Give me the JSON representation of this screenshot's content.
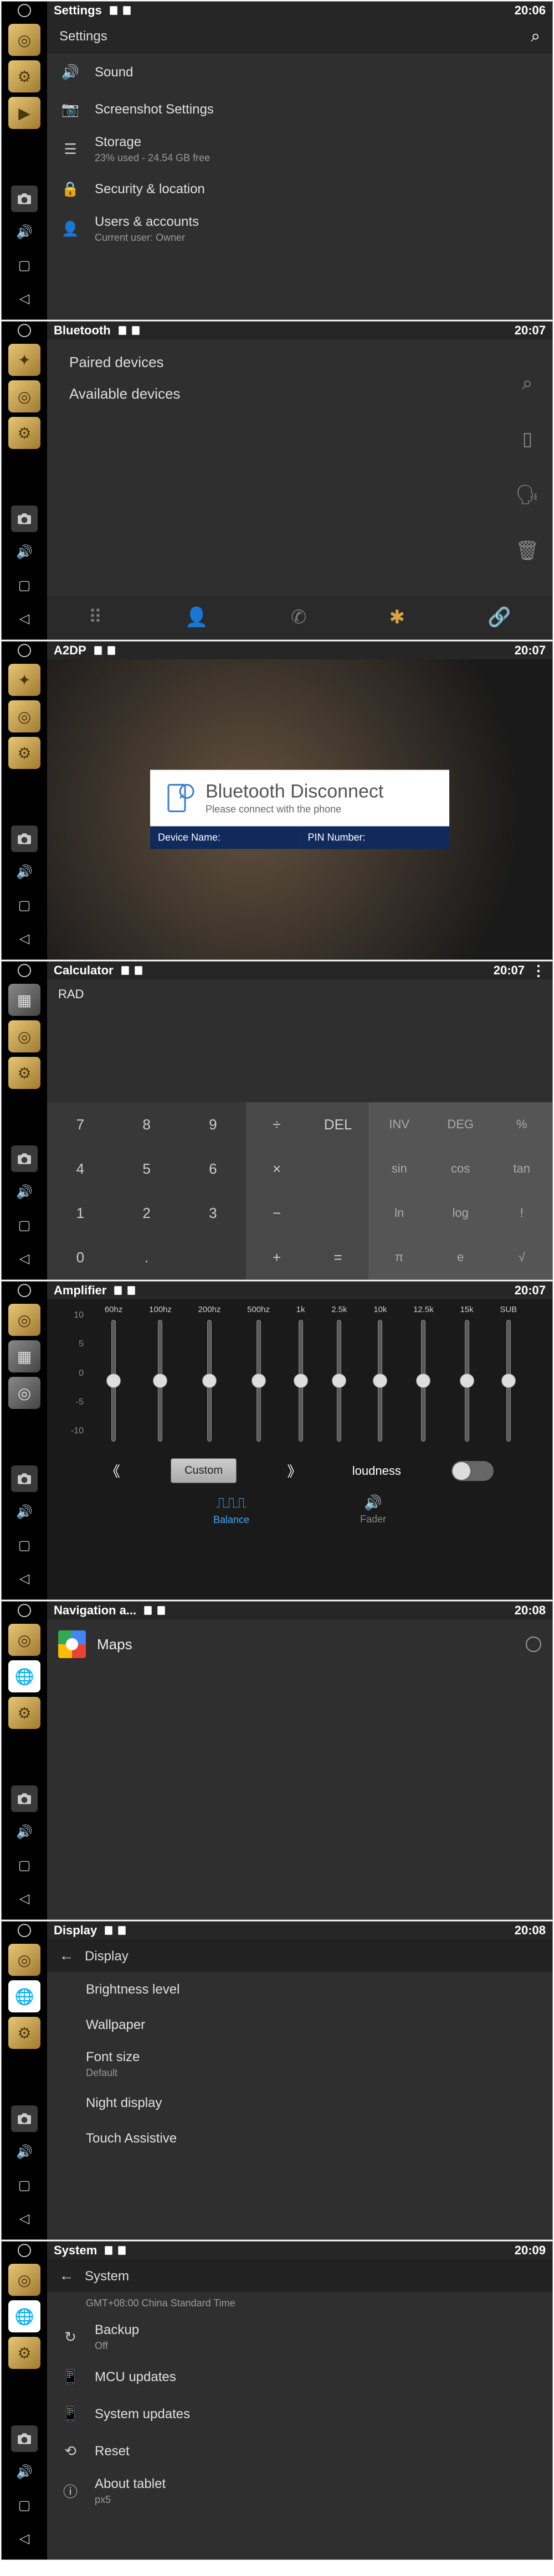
{
  "screens": [
    {
      "title": "Settings",
      "time": "20:06"
    },
    {
      "title": "Bluetooth",
      "time": "20:07"
    },
    {
      "title": "A2DP",
      "time": "20:07"
    },
    {
      "title": "Calculator",
      "time": "20:07"
    },
    {
      "title": "Amplifier",
      "time": "20:07"
    },
    {
      "title": "Navigation a...",
      "time": "20:08"
    },
    {
      "title": "Display",
      "time": "20:08"
    },
    {
      "title": "System",
      "time": "20:09"
    }
  ],
  "settings": {
    "header": "Settings",
    "items": [
      {
        "label": "Sound"
      },
      {
        "label": "Screenshot Settings"
      },
      {
        "label": "Storage",
        "sub": "23% used - 24.54 GB free"
      },
      {
        "label": "Security & location"
      },
      {
        "label": "Users & accounts",
        "sub": "Current user: Owner"
      }
    ]
  },
  "bluetooth": {
    "paired": "Paired devices",
    "available": "Available devices"
  },
  "a2dp": {
    "title": "Bluetooth Disconnect",
    "sub": "Please connect with the phone",
    "device_name_label": "Device Name:",
    "pin_label": "PIN Number:"
  },
  "calc": {
    "mode": "RAD",
    "nums": [
      "7",
      "8",
      "9",
      "4",
      "5",
      "6",
      "1",
      "2",
      "3",
      "0",
      ".",
      ""
    ],
    "ops": [
      "÷",
      "DEL",
      "×",
      "",
      "−",
      "",
      "+",
      "="
    ],
    "fns": [
      "INV",
      "DEG",
      "%",
      "sin",
      "cos",
      "tan",
      "ln",
      "log",
      "!",
      "π",
      "e",
      "√"
    ]
  },
  "eq": {
    "bands": [
      "60hz",
      "100hz",
      "200hz",
      "500hz",
      "1k",
      "2.5k",
      "10k",
      "12.5k",
      "15k",
      "SUB"
    ],
    "scale": [
      "10",
      "5",
      "0",
      "-5",
      "-10"
    ],
    "custom": "Custom",
    "loudness": "loudness",
    "balance": "Balance",
    "fader": "Fader"
  },
  "nav": {
    "maps": "Maps"
  },
  "display": {
    "header": "Display",
    "items": [
      {
        "label": "Brightness level"
      },
      {
        "label": "Wallpaper"
      },
      {
        "label": "Font size",
        "sub": "Default"
      },
      {
        "label": "Night display"
      },
      {
        "label": "Touch Assistive"
      }
    ]
  },
  "system": {
    "header": "System",
    "sub": "GMT+08:00 China Standard Time",
    "items": [
      {
        "label": "Backup",
        "sub": "Off"
      },
      {
        "label": "MCU updates"
      },
      {
        "label": "System updates"
      },
      {
        "label": "Reset"
      },
      {
        "label": "About tablet",
        "sub": "px5"
      }
    ]
  }
}
